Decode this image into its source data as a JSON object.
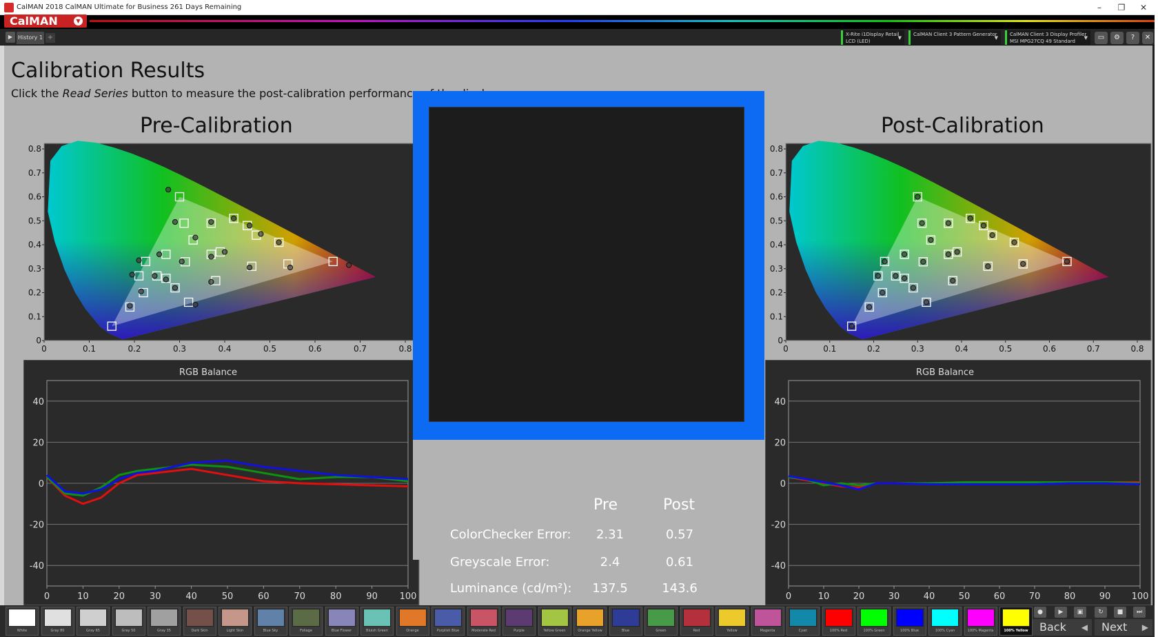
{
  "window": {
    "title": "CalMAN 2018 CalMAN Ultimate for Business 261 Days Remaining",
    "minimize": "–",
    "restore": "❐",
    "close": "✕"
  },
  "brand": {
    "logo": "CalMAN"
  },
  "toolbar": {
    "tab_label": "History 1",
    "add_tab": "+",
    "devices": [
      {
        "line1": "X-Rite i1Display Retail",
        "line2": "LCD (LED)",
        "status_color": "#3ad13a"
      },
      {
        "line1": "CalMAN Client 3 Pattern Generator",
        "line2": "",
        "status_color": "#3ad13a"
      },
      {
        "line1": "CalMAN Client 3 Display Profiler",
        "line2": "MSI MPG27CQ 49 Standard",
        "status_color": "#3ad13a"
      }
    ],
    "icons": [
      "monitor-icon",
      "gear-icon",
      "help-icon",
      "close-icon"
    ]
  },
  "page": {
    "title": "Calibration Results",
    "subtitle_before": "Click the ",
    "subtitle_em": "Read Series",
    "subtitle_after": " button to measure the post-calibration performance of the display.",
    "pre_title": "Pre-Calibration",
    "post_title": "Post-Calibration"
  },
  "cie_axes": {
    "x_ticks": [
      "0",
      "0.1",
      "0.2",
      "0.3",
      "0.4",
      "0.5",
      "0.6",
      "0.7",
      "0.8"
    ],
    "y_ticks": [
      "0",
      "0.1",
      "0.2",
      "0.3",
      "0.4",
      "0.5",
      "0.6",
      "0.7",
      "0.8"
    ]
  },
  "chart_data": [
    {
      "type": "scatter",
      "title": "Pre-Calibration",
      "xlim": [
        0,
        0.8
      ],
      "ylim": [
        0,
        0.8
      ],
      "targets": [
        [
          0.64,
          0.33
        ],
        [
          0.3,
          0.6
        ],
        [
          0.15,
          0.06
        ],
        [
          0.3127,
          0.329
        ],
        [
          0.225,
          0.33
        ],
        [
          0.21,
          0.27
        ],
        [
          0.22,
          0.2
        ],
        [
          0.19,
          0.14
        ],
        [
          0.32,
          0.16
        ],
        [
          0.38,
          0.25
        ],
        [
          0.37,
          0.36
        ],
        [
          0.39,
          0.37
        ],
        [
          0.46,
          0.31
        ],
        [
          0.54,
          0.32
        ],
        [
          0.52,
          0.41
        ],
        [
          0.47,
          0.44
        ],
        [
          0.45,
          0.48
        ],
        [
          0.42,
          0.51
        ],
        [
          0.31,
          0.49
        ],
        [
          0.27,
          0.36
        ],
        [
          0.25,
          0.27
        ],
        [
          0.27,
          0.26
        ],
        [
          0.29,
          0.22
        ],
        [
          0.33,
          0.42
        ],
        [
          0.37,
          0.49
        ]
      ],
      "measured": [
        [
          0.675,
          0.315
        ],
        [
          0.275,
          0.63
        ],
        [
          0.305,
          0.33
        ],
        [
          0.21,
          0.335
        ],
        [
          0.195,
          0.275
        ],
        [
          0.215,
          0.205
        ],
        [
          0.19,
          0.145
        ],
        [
          0.335,
          0.15
        ],
        [
          0.37,
          0.245
        ],
        [
          0.37,
          0.35
        ],
        [
          0.4,
          0.37
        ],
        [
          0.455,
          0.305
        ],
        [
          0.545,
          0.305
        ],
        [
          0.52,
          0.41
        ],
        [
          0.48,
          0.445
        ],
        [
          0.455,
          0.48
        ],
        [
          0.42,
          0.51
        ],
        [
          0.29,
          0.495
        ],
        [
          0.255,
          0.36
        ],
        [
          0.245,
          0.27
        ],
        [
          0.27,
          0.255
        ],
        [
          0.29,
          0.22
        ],
        [
          0.335,
          0.43
        ],
        [
          0.37,
          0.495
        ]
      ]
    },
    {
      "type": "scatter",
      "title": "Post-Calibration",
      "xlim": [
        0,
        0.8
      ],
      "ylim": [
        0,
        0.8
      ],
      "targets": [
        [
          0.64,
          0.33
        ],
        [
          0.3,
          0.6
        ],
        [
          0.15,
          0.06
        ],
        [
          0.3127,
          0.329
        ],
        [
          0.225,
          0.33
        ],
        [
          0.21,
          0.27
        ],
        [
          0.22,
          0.2
        ],
        [
          0.19,
          0.14
        ],
        [
          0.32,
          0.16
        ],
        [
          0.38,
          0.25
        ],
        [
          0.37,
          0.36
        ],
        [
          0.39,
          0.37
        ],
        [
          0.46,
          0.31
        ],
        [
          0.54,
          0.32
        ],
        [
          0.52,
          0.41
        ],
        [
          0.47,
          0.44
        ],
        [
          0.45,
          0.48
        ],
        [
          0.42,
          0.51
        ],
        [
          0.31,
          0.49
        ],
        [
          0.27,
          0.36
        ],
        [
          0.25,
          0.27
        ],
        [
          0.27,
          0.26
        ],
        [
          0.29,
          0.22
        ],
        [
          0.33,
          0.42
        ],
        [
          0.37,
          0.49
        ]
      ],
      "measured": [
        [
          0.64,
          0.33
        ],
        [
          0.3,
          0.6
        ],
        [
          0.15,
          0.06
        ],
        [
          0.3127,
          0.329
        ],
        [
          0.225,
          0.33
        ],
        [
          0.21,
          0.27
        ],
        [
          0.22,
          0.2
        ],
        [
          0.19,
          0.14
        ],
        [
          0.32,
          0.16
        ],
        [
          0.38,
          0.25
        ],
        [
          0.37,
          0.36
        ],
        [
          0.39,
          0.37
        ],
        [
          0.46,
          0.31
        ],
        [
          0.54,
          0.32
        ],
        [
          0.52,
          0.41
        ],
        [
          0.47,
          0.44
        ],
        [
          0.45,
          0.48
        ],
        [
          0.42,
          0.51
        ],
        [
          0.31,
          0.49
        ],
        [
          0.27,
          0.36
        ],
        [
          0.25,
          0.27
        ],
        [
          0.27,
          0.26
        ],
        [
          0.29,
          0.22
        ],
        [
          0.33,
          0.42
        ],
        [
          0.37,
          0.49
        ]
      ]
    },
    {
      "type": "line",
      "title": "RGB Balance",
      "xlim": [
        0,
        100
      ],
      "ylim": [
        -50,
        50
      ],
      "x_ticks": [
        "0",
        "10",
        "20",
        "30",
        "40",
        "50",
        "60",
        "70",
        "80",
        "90",
        "100"
      ],
      "y_ticks": [
        "40",
        "20",
        "0",
        "-20",
        "-40"
      ],
      "x": [
        0,
        5,
        10,
        15,
        20,
        25,
        30,
        40,
        50,
        60,
        70,
        80,
        90,
        100
      ],
      "series": [
        {
          "color": "#e01010",
          "values": [
            3,
            -6,
            -10,
            -7,
            0,
            4,
            5,
            7,
            4,
            1,
            0,
            -0.5,
            -1,
            -1.5
          ]
        },
        {
          "color": "#109010",
          "values": [
            3,
            -5,
            -6,
            -2,
            4,
            6,
            7,
            9,
            8,
            5,
            2,
            3,
            3,
            1
          ]
        },
        {
          "color": "#1010e0",
          "values": [
            4,
            -4,
            -5,
            -3,
            2,
            5,
            6,
            10,
            11,
            8,
            6,
            4,
            3,
            2
          ]
        }
      ]
    },
    {
      "type": "line",
      "title": "RGB Balance",
      "xlim": [
        0,
        100
      ],
      "ylim": [
        -50,
        50
      ],
      "x_ticks": [
        "0",
        "10",
        "20",
        "30",
        "40",
        "50",
        "60",
        "70",
        "80",
        "90",
        "100"
      ],
      "y_ticks": [
        "40",
        "20",
        "0",
        "-20",
        "-40"
      ],
      "x": [
        0,
        5,
        10,
        15,
        20,
        25,
        30,
        40,
        50,
        60,
        70,
        80,
        90,
        100
      ],
      "series": [
        {
          "color": "#e01010",
          "values": [
            3,
            1.5,
            0,
            -1.5,
            -2,
            0,
            0,
            0,
            0,
            0,
            0,
            0.5,
            0.5,
            0.5
          ]
        },
        {
          "color": "#109010",
          "values": [
            3,
            2,
            -1,
            0,
            -1,
            0,
            0,
            0,
            0.5,
            0.5,
            0.5,
            0.5,
            0.5,
            0
          ]
        },
        {
          "color": "#1010e0",
          "values": [
            3.5,
            2,
            0.5,
            -1,
            -3,
            0,
            0,
            -0.5,
            -0.5,
            -0.5,
            -0.5,
            0,
            0,
            -0.5
          ]
        }
      ]
    }
  ],
  "stats": {
    "pre_header": "Pre",
    "post_header": "Post",
    "rows": [
      {
        "label": "ColorChecker Error:",
        "pre": "2.31",
        "post": "0.57"
      },
      {
        "label": "Greyscale Error:",
        "pre": "2.4",
        "post": "0.61"
      },
      {
        "label": "Luminance (cd/m²):",
        "pre": "137.5",
        "post": "143.6"
      }
    ]
  },
  "swatches": [
    {
      "label": "White",
      "color": "#ffffff"
    },
    {
      "label": "Gray 80",
      "color": "#e0e0e0"
    },
    {
      "label": "Gray 65",
      "color": "#cfcfcf"
    },
    {
      "label": "Gray 50",
      "color": "#bdbdbd"
    },
    {
      "label": "Gray 35",
      "color": "#a0a0a0"
    },
    {
      "label": "Dark Skin",
      "color": "#73514a"
    },
    {
      "label": "Light Skin",
      "color": "#c4978a"
    },
    {
      "label": "Blue Sky",
      "color": "#6082a8"
    },
    {
      "label": "Foliage",
      "color": "#5a6b46"
    },
    {
      "label": "Blue Flower",
      "color": "#8886b8"
    },
    {
      "label": "Bluish Green",
      "color": "#6ac2b4"
    },
    {
      "label": "Orange",
      "color": "#e0782a"
    },
    {
      "label": "Purplish Blue",
      "color": "#4a5ca8"
    },
    {
      "label": "Moderate Red",
      "color": "#c85466"
    },
    {
      "label": "Purple",
      "color": "#5c3c70"
    },
    {
      "label": "Yellow Green",
      "color": "#a4c444"
    },
    {
      "label": "Orange Yellow",
      "color": "#e8a22c"
    },
    {
      "label": "Blue",
      "color": "#2e3c98"
    },
    {
      "label": "Green",
      "color": "#489a48"
    },
    {
      "label": "Red",
      "color": "#b4303c"
    },
    {
      "label": "Yellow",
      "color": "#ecca2c"
    },
    {
      "label": "Magenta",
      "color": "#c0549a"
    },
    {
      "label": "Cyan",
      "color": "#1488a8"
    },
    {
      "label": "100% Red",
      "color": "#ff0000"
    },
    {
      "label": "100% Green",
      "color": "#00ff00"
    },
    {
      "label": "100% Blue",
      "color": "#0000ff"
    },
    {
      "label": "100% Cyan",
      "color": "#00ffff"
    },
    {
      "label": "100% Magenta",
      "color": "#ff00ff"
    },
    {
      "label": "100% Yellow",
      "color": "#ffff00"
    }
  ],
  "nav": {
    "back": "Back",
    "next": "Next"
  }
}
